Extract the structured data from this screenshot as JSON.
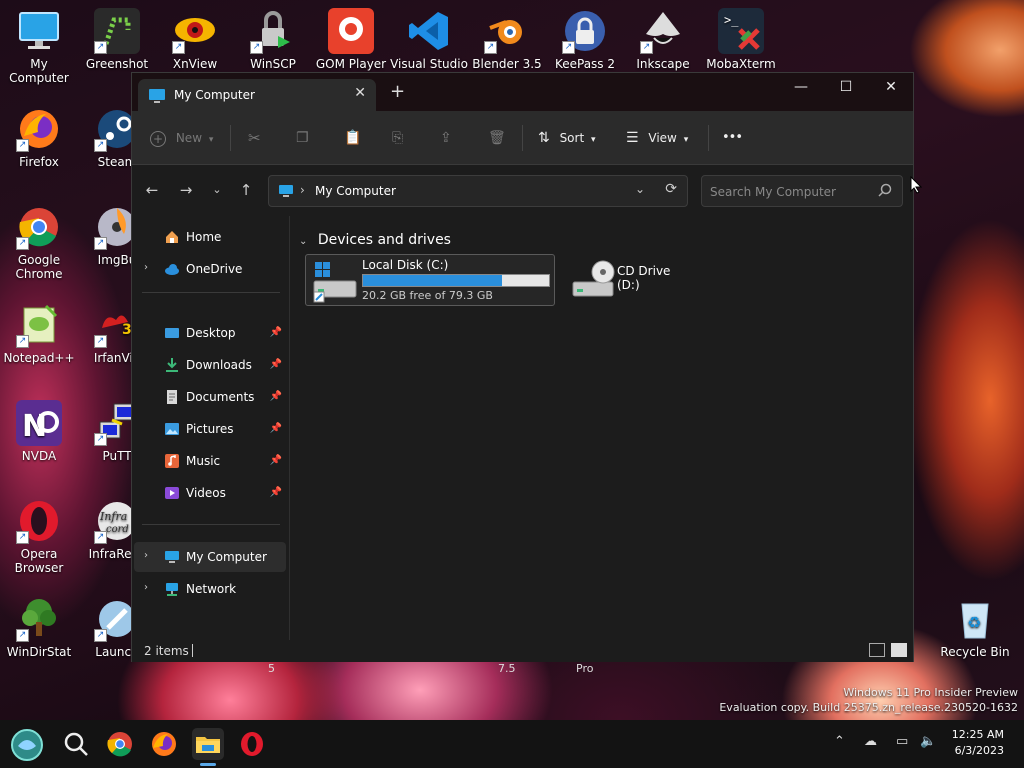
{
  "desktop": {
    "icons": [
      {
        "label": "My Computer"
      },
      {
        "label": "Greenshot"
      },
      {
        "label": "XnView"
      },
      {
        "label": "WinSCP"
      },
      {
        "label": "GOM Player"
      },
      {
        "label": "Visual Studio"
      },
      {
        "label": "Blender 3.5"
      },
      {
        "label": "KeePass 2"
      },
      {
        "label": "Inkscape"
      },
      {
        "label": "MobaXterm"
      },
      {
        "label": "Firefox"
      },
      {
        "label": "Steam"
      },
      {
        "label": "Google Chrome"
      },
      {
        "label": "ImgBu"
      },
      {
        "label": "Notepad++"
      },
      {
        "label": "IrfanVie"
      },
      {
        "label": "NVDA"
      },
      {
        "label": "PuTT"
      },
      {
        "label": "Opera Browser"
      },
      {
        "label": "InfraReco"
      },
      {
        "label": "WinDirStat"
      },
      {
        "label": "Launch"
      },
      {
        "label": "Recycle Bin"
      }
    ],
    "behind_window_labels": [
      "5",
      "7.5",
      "Pro"
    ],
    "watermark": {
      "line1": "Windows 11 Pro Insider Preview",
      "line2": "Evaluation copy. Build 25375.zn_release.230520-1632"
    }
  },
  "window": {
    "tab_title": "My Computer",
    "tab_close": "✕",
    "new_tab": "+",
    "controls": {
      "minimize": "—",
      "maximize": "☐",
      "close": "✕"
    },
    "toolbar": {
      "new_label": "New",
      "sort_label": "Sort",
      "view_label": "View",
      "more_label": "•••"
    },
    "address": {
      "path": "My Computer",
      "search_placeholder": "Search My Computer"
    },
    "sidebar": {
      "items": [
        {
          "label": "Home"
        },
        {
          "label": "OneDrive"
        },
        {
          "label": "Desktop"
        },
        {
          "label": "Downloads"
        },
        {
          "label": "Documents"
        },
        {
          "label": "Pictures"
        },
        {
          "label": "Music"
        },
        {
          "label": "Videos"
        },
        {
          "label": "My Computer"
        },
        {
          "label": "Network"
        }
      ]
    },
    "content": {
      "group_title": "Devices and drives",
      "drives": [
        {
          "name": "Local Disk (C:)",
          "free_text": "20.2 GB free of 79.3 GB",
          "used_fraction": 0.745
        },
        {
          "name": "CD Drive (D:)"
        }
      ]
    },
    "status": {
      "items_count": "2 items"
    }
  },
  "taskbar": {
    "clock_time": "12:25 AM",
    "clock_date": "6/3/2023"
  },
  "colors": {
    "accent": "#2a8fdc",
    "window_bg": "#1c1c1c",
    "toolbar_bg": "#2b2b2b",
    "taskbar_bg": "#131313"
  }
}
